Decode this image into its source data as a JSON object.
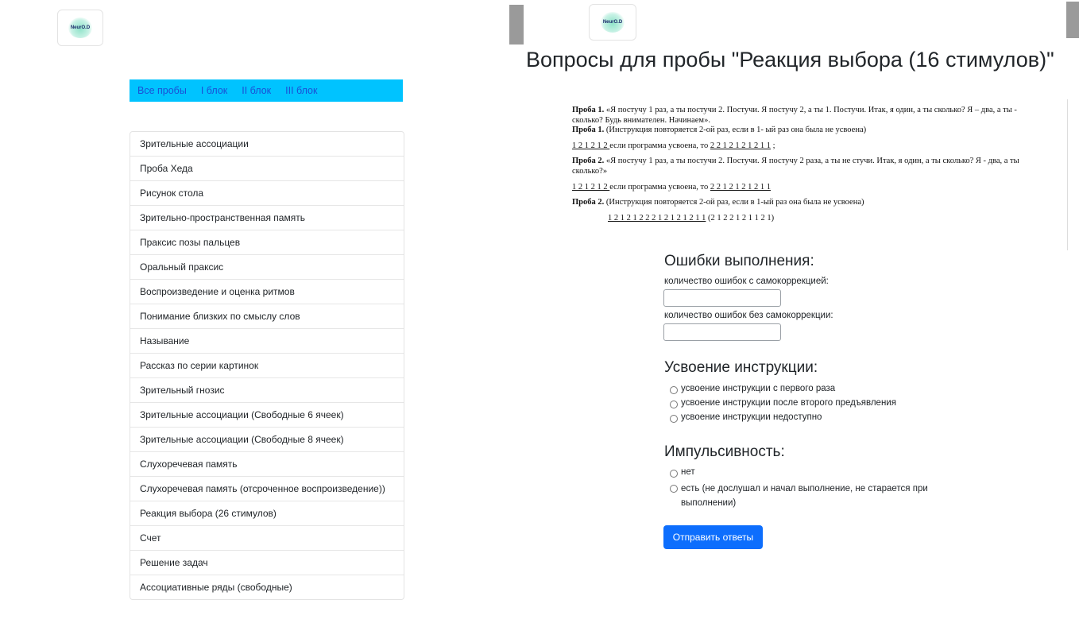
{
  "left": {
    "logo_text": "NeurO.D",
    "nav": [
      "Все пробы",
      "I блок",
      "II блок",
      "III блок"
    ],
    "tests": [
      "Зрительные ассоциации",
      "Проба Хеда",
      "Рисунок стола",
      "Зрительно-пространственная память",
      "Праксис позы пальцев",
      "Оральный праксис",
      "Воспроизведение и оценка ритмов",
      "Понимание близких по смыслу слов",
      "Называние",
      "Рассказ по серии картинок",
      "Зрительный гнозис",
      "Зрительные ассоциации (Свободные 6 ячеек)",
      "Зрительные ассоциации (Свободные 8 ячеек)",
      "Слухоречевая память",
      "Слухоречевая память (отсроченное воспроизведение))",
      "Реакция выбора (26 стимулов)",
      "Счет",
      "Решение задач",
      "Ассоциативные ряды (свободные)"
    ]
  },
  "right": {
    "logo_text": "NeurO.D",
    "title": "Вопросы для пробы \"Реакция выбора (16 стимулов)\"",
    "instructions": {
      "p1_label": "Проба 1.",
      "p1_text": " «Я постучу 1 раз, а ты постучи 2. Постучи. Я постучу  2, а ты 1. Постучи. Итак, я один, а ты сколько? Я – два, а ты  - сколько? Будь внимателен. Начинаем».",
      "p1b_label": "Проба 1.",
      "p1b_text": "  (Инструкция повторяется 2-ой раз, если в 1- ый раз она была не усвоена)",
      "seq1_a": "1   2   1   2   1   2 ",
      "seq1_mid": " если программа усвоена, то ",
      "seq1_b": "2   2   1   2   1   2   1   2   1   1",
      "seq1_end": " ;",
      "p2_label": "Проба  2.",
      "p2_text": " «Я постучу 1 раз, а ты постучи 2. Постучи. Я постучу 2 раза, а ты не стучи. Итак, я один, а ты сколько? Я  - два, а ты сколько?»",
      "seq2_a": "1   2   1   2   1   2 ",
      "seq2_mid": " если программа усвоена, то ",
      "seq2_b": "2  2   1   2   1   2   1   2   1   1",
      "p3_label": "Проба  2.",
      "p3_text": " (Инструкция повторяется 2-ой раз, если в 1-ый раз она была не усвоена)",
      "seq3_a": "1   2   1   2   1   2   2   2   1   2   1   2   1   2   1   1",
      "seq3_b": " (2   1   2   2   1   2   1   1   2   1)"
    },
    "errors": {
      "heading": "Ошибки выполнения:",
      "with_correction_label": "количество ошибок с самокоррекцией:",
      "with_correction_value": "",
      "without_correction_label": "количество ошибок без самокоррекции:",
      "without_correction_value": ""
    },
    "learning": {
      "heading": "Усвоение инструкции:",
      "options": [
        "усвоение инструкции с первого раза",
        "усвоение инструкции после второго предъявления",
        "усвоение инструкции недоступно"
      ]
    },
    "impulsivity": {
      "heading": "Импульсивность:",
      "options": [
        "нет",
        "есть (не дослушал и начал выполнение, не старается при выполнении)"
      ]
    },
    "submit_label": "Отправить ответы"
  }
}
